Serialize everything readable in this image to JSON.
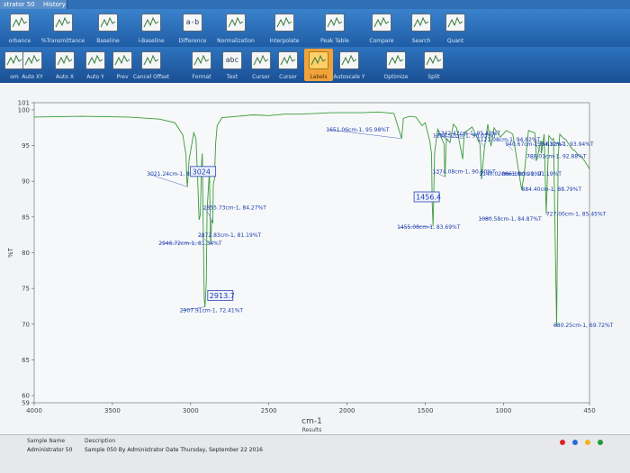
{
  "titlebar": {
    "app": "strator 50",
    "history_tab": "History"
  },
  "ribbon_top": {
    "items": [
      {
        "label": "orbance",
        "icon": "absorbance-icon"
      },
      {
        "label": "%Transmittance",
        "icon": "transmittance-icon"
      },
      {
        "label": "Baseline",
        "icon": "baseline-icon"
      },
      {
        "label": "i-Baseline",
        "icon": "i-baseline-icon"
      },
      {
        "label": "Difference",
        "icon": "difference-icon"
      },
      {
        "label": "Normalization",
        "icon": "normalization-icon"
      },
      {
        "label": "Interpolate",
        "icon": "interpolate-icon"
      },
      {
        "label": "Peak Table",
        "icon": "peak-table-icon"
      },
      {
        "label": "Compare",
        "icon": "compare-icon"
      },
      {
        "label": "Search",
        "icon": "search-icon"
      },
      {
        "label": "Quant",
        "icon": "quant-icon"
      }
    ],
    "difference_glyph": "a-b"
  },
  "ribbon_bottom": {
    "items": [
      {
        "label": "om",
        "icon": "zoom-icon"
      },
      {
        "label": "Auto XY",
        "icon": "auto-xy-icon"
      },
      {
        "label": "Auto X",
        "icon": "auto-x-icon"
      },
      {
        "label": "Auto Y",
        "icon": "auto-y-icon"
      },
      {
        "label": "Prev",
        "icon": "prev-icon"
      },
      {
        "label": "Cancel Offset",
        "icon": "cancel-offset-icon"
      },
      {
        "label": "Format",
        "icon": "format-icon"
      },
      {
        "label": "Text",
        "icon": "text-icon"
      },
      {
        "label": "Cursor",
        "icon": "cursor-icon"
      },
      {
        "label": "Cursor",
        "icon": "cursor2-icon"
      },
      {
        "label": "Labels",
        "icon": "labels-icon",
        "active": true
      },
      {
        "label": "Autoscale Y",
        "icon": "autoscale-y-icon"
      },
      {
        "label": "Optimize",
        "icon": "optimize-icon"
      },
      {
        "label": "Split",
        "icon": "split-icon"
      }
    ],
    "text_glyph": "abc"
  },
  "chart_data": {
    "type": "line",
    "title": "",
    "xlabel": "cm-1",
    "ylabel": "%T",
    "legend_title": "Results",
    "xlim": [
      4000,
      450
    ],
    "ylim": [
      59,
      101
    ],
    "x_ticks": [
      "4000",
      "3500",
      "3000",
      "2500",
      "2000",
      "1500",
      "1000",
      "450"
    ],
    "y_ticks": [
      "101",
      "100",
      "95",
      "90",
      "85",
      "80",
      "75",
      "70",
      "65",
      "60",
      "59"
    ],
    "series": [
      {
        "x": [
          4000,
          3700,
          3400,
          3200,
          3100,
          3050,
          3030,
          3024,
          3021,
          3010,
          2980,
          2966,
          2955,
          2946,
          2938,
          2930,
          2925,
          2920,
          2913,
          2908,
          2900,
          2895,
          2880,
          2872,
          2866,
          2858,
          2855,
          2848,
          2840,
          2830,
          2800,
          2700,
          2600,
          2500,
          2400,
          2300,
          2200,
          2100,
          2000,
          1900,
          1800,
          1700,
          1651,
          1640,
          1600,
          1560,
          1520,
          1500,
          1470,
          1460,
          1456,
          1450,
          1440,
          1420,
          1400,
          1380,
          1374,
          1365,
          1342,
          1320,
          1300,
          1260,
          1258,
          1250,
          1200,
          1150,
          1140,
          1121,
          1100,
          1080,
          1060,
          1020,
          980,
          940,
          884,
          866,
          840,
          800,
          788,
          760,
          757,
          740,
          727,
          710,
          690,
          680,
          660,
          650,
          640,
          620,
          600,
          580,
          560,
          540,
          520,
          500,
          480,
          460,
          450
        ],
        "y": [
          99.0,
          99.1,
          99.0,
          98.7,
          98.2,
          96.5,
          93.8,
          90.3,
          89.2,
          93.0,
          96.8,
          96.0,
          90.4,
          84.6,
          85.3,
          92.6,
          93.9,
          84.4,
          73.7,
          72.4,
          75.8,
          86.0,
          91.4,
          81.1,
          84.5,
          84.2,
          89.6,
          90.2,
          95.3,
          97.8,
          98.9,
          99.1,
          99.3,
          99.2,
          99.4,
          99.4,
          99.5,
          99.6,
          99.6,
          99.6,
          99.7,
          99.5,
          96.0,
          98.8,
          99.1,
          99.0,
          97.8,
          98.2,
          95.5,
          93.8,
          87.0,
          83.7,
          94.0,
          97.3,
          96.3,
          95.2,
          90.6,
          96.0,
          95.4,
          98.0,
          97.5,
          93.1,
          94.4,
          96.8,
          97.6,
          95.2,
          90.3,
          94.8,
          98.0,
          94.9,
          97.5,
          96.2,
          97.1,
          96.6,
          88.8,
          91.2,
          97.1,
          96.8,
          92.9,
          95.7,
          93.9,
          96.6,
          85.5,
          96.4,
          95.8,
          96.0,
          69.7,
          93.5,
          96.6,
          96.1,
          95.8,
          95.1,
          94.5,
          94.2,
          93.6,
          93.4,
          92.8,
          92.1,
          91.7
        ]
      }
    ],
    "box_labels": [
      {
        "text": "3024",
        "x": 3024,
        "y": 90.3
      },
      {
        "text": "2913.7",
        "x": 2913.7,
        "y": 73.7
      },
      {
        "text": "1456.4",
        "x": 1456.4,
        "y": 87.0
      }
    ],
    "peak_labels": [
      {
        "text": "3021.24cm-1, 89.24%T",
        "x": 3021.24,
        "y": 89.24
      },
      {
        "text": "2855.73cm-1, 84.27%T",
        "x": 2855.73,
        "y": 84.27
      },
      {
        "text": "2872.83cm-1, 81.19%T",
        "x": 2872.83,
        "y": 81.19
      },
      {
        "text": "2946.72cm-1, 81.34%T",
        "x": 2946.72,
        "y": 81.34
      },
      {
        "text": "2907.91cm-1, 72.41%T",
        "x": 2907.91,
        "y": 72.41
      },
      {
        "text": "1651.06cm-1, 95.98%T",
        "x": 1651.06,
        "y": 95.98
      },
      {
        "text": "1342.47cm-1, 95.43%T",
        "x": 1342.47,
        "y": 95.43
      },
      {
        "text": "1121.08cm-1, 94.82%T",
        "x": 1121.08,
        "y": 94.82
      },
      {
        "text": "1258.52cm-1, 96.03%T",
        "x": 1258.52,
        "y": 96.03
      },
      {
        "text": "757.61cm-1, 93.94%T",
        "x": 757.61,
        "y": 93.94
      },
      {
        "text": "788.01cm-1, 92.88%T",
        "x": 788.01,
        "y": 92.88
      },
      {
        "text": "940.67cm-1, 94.32%T",
        "x": 940.67,
        "y": 94.32
      },
      {
        "text": "866.18cm-1, 91.19%T",
        "x": 866.18,
        "y": 91.19
      },
      {
        "text": "1374.08cm-1, 90.60%T",
        "x": 1374.08,
        "y": 90.6
      },
      {
        "text": "1140.02cm-1, 90.29%T",
        "x": 1140.02,
        "y": 90.29
      },
      {
        "text": "884.40cm-1, 88.79%T",
        "x": 884.4,
        "y": 88.79
      },
      {
        "text": "727.00cm-1, 85.45%T",
        "x": 727.0,
        "y": 85.45
      },
      {
        "text": "1080.58cm-1, 84.87%T",
        "x": 1080.58,
        "y": 84.87
      },
      {
        "text": "1455.08cm-1, 83.69%T",
        "x": 1455.08,
        "y": 83.69
      },
      {
        "text": "680.25cm-1, 69.72%T",
        "x": 680.25,
        "y": 69.72
      }
    ],
    "grid": false,
    "line_color": "#3a9a3a"
  },
  "status": {
    "col_name": "Sample Name",
    "col_desc": "Description",
    "row_name": "Administrator 50",
    "row_desc": "Sample 050 By Administrator Date Thursday, September 22 2016",
    "dot_colors": [
      "#d9262b",
      "#2b6cd9",
      "#f0b41b",
      "#1e9e3a"
    ]
  }
}
